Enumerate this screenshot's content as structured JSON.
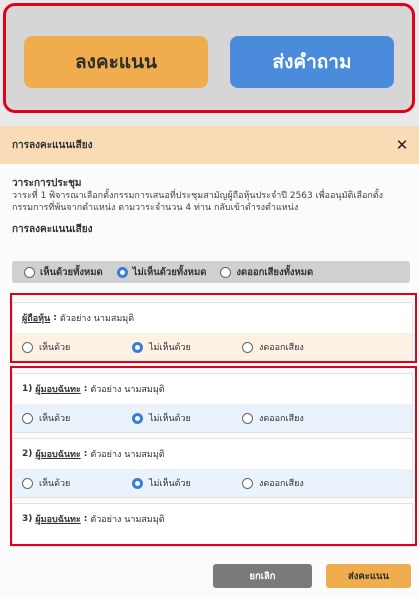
{
  "top": {
    "vote_label": "ลงคะแนน",
    "ask_label": "ส่งคำถาม"
  },
  "modal": {
    "title": "การลงคะแนนเสียง",
    "close_icon": "close-icon",
    "agenda_title": "วาระการประชุม",
    "agenda_desc": "วาระที่ 1 พิจารณาเลือกตั้งกรรมการเสนอที่ประชุมสามัญผู้ถือหุ้นประจำปี 2563 เพื่ออนุมัติเลือกตั้งกรรมการที่พ้นจากตำแหน่ง ตามวาระจำนวน 4 ท่าน กลับเข้าดำรงตำแหน่ง",
    "vote_section_title": "การลงคะแนนเสียง",
    "all_options": {
      "approve_all": "เห็นด้วยทั้งหมด",
      "disapprove_all": "ไม่เห็นด้วยทั้งหมด",
      "abstain_all": "งดออกเสียงทั้งหมด",
      "selected": "disapprove_all"
    },
    "shareholder": {
      "label": "ผู้ถือหุ้น",
      "sep": ":",
      "name": "ตัวอย่าง นามสมมุติ",
      "approve": "เห็นด้วย",
      "disapprove": "ไม่เห็นด้วย",
      "abstain": "งดออกเสียง",
      "selected": "disapprove"
    },
    "proxies": [
      {
        "num": "1)",
        "label": "ผู้มอบฉันทะ",
        "sep": ":",
        "name": "ตัวอย่าง นามสมมุติ",
        "approve": "เห็นด้วย",
        "disapprove": "ไม่เห็นด้วย",
        "abstain": "งดออกเสียง",
        "selected": "disapprove"
      },
      {
        "num": "2)",
        "label": "ผู้มอบฉันทะ",
        "sep": ":",
        "name": "ตัวอย่าง นามสมมุติ",
        "approve": "เห็นด้วย",
        "disapprove": "ไม่เห็นด้วย",
        "abstain": "งดออกเสียง",
        "selected": "disapprove"
      },
      {
        "num": "3)",
        "label": "ผู้มอบฉันทะ",
        "sep": ":",
        "name": "ตัวอย่าง นามสมมุติ"
      }
    ],
    "cancel_label": "ยกเลิก",
    "submit_label": "ส่งคะแนน"
  },
  "colors": {
    "accent_orange": "#efad4e",
    "accent_blue": "#4a8bdc",
    "highlight_red": "#e0001b",
    "header_bg": "#f9dcb6"
  }
}
